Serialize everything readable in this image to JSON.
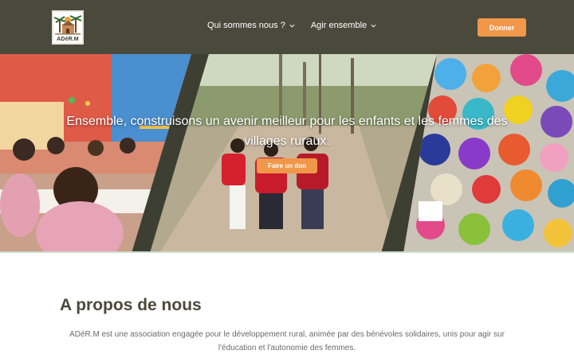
{
  "header": {
    "logo_text": "ADéR.M",
    "nav": [
      {
        "label": "Qui sommes nous ?"
      },
      {
        "label": "Agir ensemble"
      }
    ],
    "donate_label": "Donner"
  },
  "hero": {
    "title": "Ensemble, construisons un avenir meilleur pour les enfants et les femmes des villages ruraux.",
    "button_label": "Faire un don"
  },
  "about": {
    "title": "A propos de nous",
    "text": "ADéR.M est une association engagée pour le développement rural, animée par des bénévoles solidaires, unis pour agir sur l'éducation et l'autonomie des femmes."
  },
  "colors": {
    "header_bg": "#4a4a3c",
    "accent": "#f0974a",
    "title": "#4a4a3c"
  }
}
